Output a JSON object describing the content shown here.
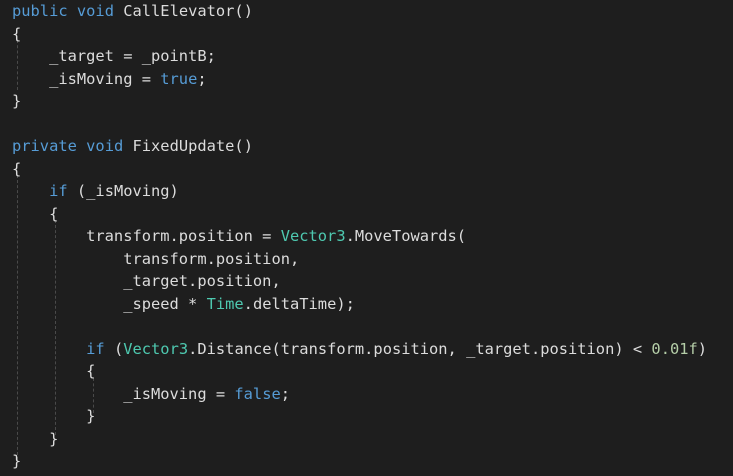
{
  "code": {
    "lines": [
      [
        {
          "t": "public",
          "c": "kw"
        },
        {
          "t": " "
        },
        {
          "t": "void",
          "c": "kw"
        },
        {
          "t": " CallElevator()"
        }
      ],
      [
        {
          "t": "{"
        }
      ],
      [
        {
          "t": "    _target = _pointB;"
        }
      ],
      [
        {
          "t": "    _isMoving = "
        },
        {
          "t": "true",
          "c": "kw"
        },
        {
          "t": ";"
        }
      ],
      [
        {
          "t": "}"
        }
      ],
      [],
      [
        {
          "t": "private",
          "c": "kw"
        },
        {
          "t": " "
        },
        {
          "t": "void",
          "c": "kw"
        },
        {
          "t": " FixedUpdate()"
        }
      ],
      [
        {
          "t": "{"
        }
      ],
      [
        {
          "t": "    "
        },
        {
          "t": "if",
          "c": "kw"
        },
        {
          "t": " (_isMoving)"
        }
      ],
      [
        {
          "t": "    {"
        }
      ],
      [
        {
          "t": "        transform.position = "
        },
        {
          "t": "Vector3",
          "c": "ty"
        },
        {
          "t": ".MoveTowards("
        }
      ],
      [
        {
          "t": "            transform.position,"
        }
      ],
      [
        {
          "t": "            _target.position,"
        }
      ],
      [
        {
          "t": "            _speed * "
        },
        {
          "t": "Time",
          "c": "ty"
        },
        {
          "t": ".deltaTime);"
        }
      ],
      [],
      [
        {
          "t": "        "
        },
        {
          "t": "if",
          "c": "kw"
        },
        {
          "t": " ("
        },
        {
          "t": "Vector3",
          "c": "ty"
        },
        {
          "t": ".Distance(transform.position, _target.position) < "
        },
        {
          "t": "0.01f",
          "c": "num"
        },
        {
          "t": ")"
        }
      ],
      [
        {
          "t": "        {"
        }
      ],
      [
        {
          "t": "            _isMoving = "
        },
        {
          "t": "false",
          "c": "kw"
        },
        {
          "t": ";"
        }
      ],
      [
        {
          "t": "        }"
        }
      ],
      [
        {
          "t": "    }"
        }
      ],
      [
        {
          "t": "}"
        }
      ]
    ]
  }
}
